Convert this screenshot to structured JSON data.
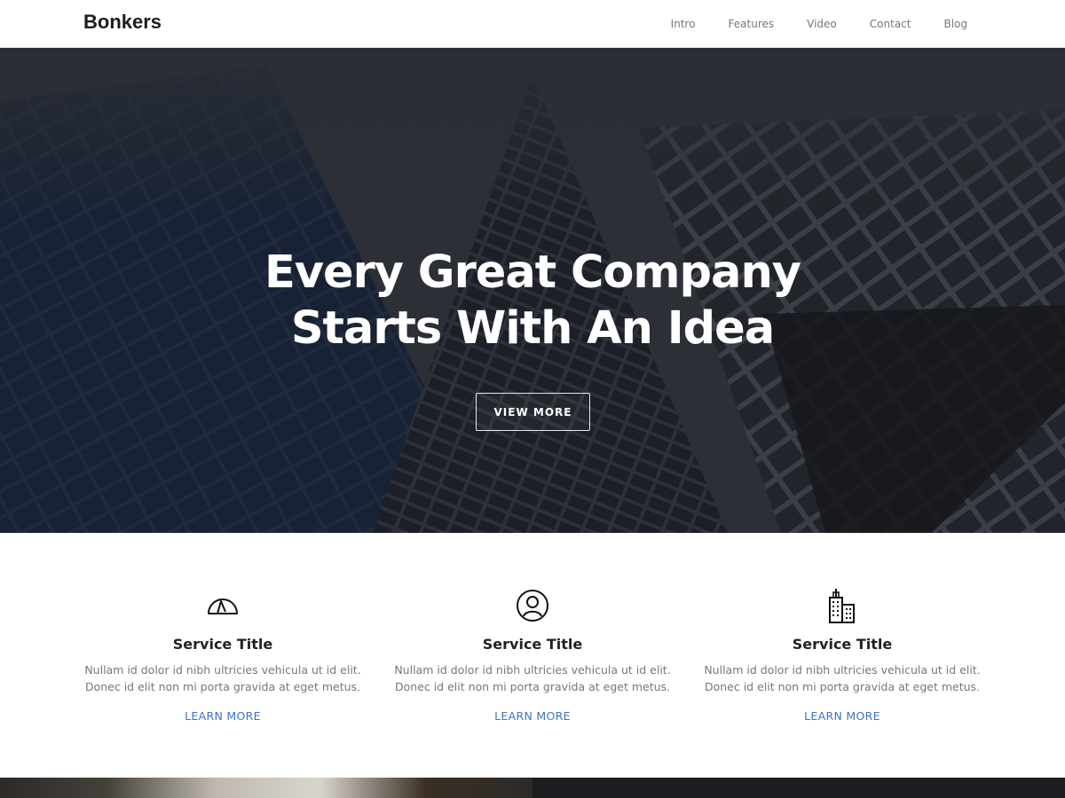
{
  "header": {
    "brand": "Bonkers",
    "nav": [
      "Intro",
      "Features",
      "Video",
      "Contact",
      "Blog"
    ]
  },
  "hero": {
    "title_line1": "Every Great Company",
    "title_line2": "Starts With An Idea",
    "button_label": "VIEW MORE"
  },
  "services": [
    {
      "icon": "speedometer-icon",
      "title": "Service Title",
      "text_line1": "Nullam id dolor id nibh ultricies vehicula ut id elit.",
      "text_line2": "Donec id elit non mi porta gravida at eget metus.",
      "link": "LEARN MORE"
    },
    {
      "icon": "user-circle-icon",
      "title": "Service Title",
      "text_line1": "Nullam id dolor id nibh ultricies vehicula ut id elit.",
      "text_line2": "Donec id elit non mi porta gravida at eget metus.",
      "link": "LEARN MORE"
    },
    {
      "icon": "buildings-icon",
      "title": "Service Title",
      "text_line1": "Nullam id dolor id nibh ultricies vehicula ut id elit.",
      "text_line2": "Donec id elit non mi porta gravida at eget metus.",
      "link": "LEARN MORE"
    }
  ],
  "colors": {
    "link": "#3b73c8",
    "hero_overlay": "#1e2230"
  }
}
